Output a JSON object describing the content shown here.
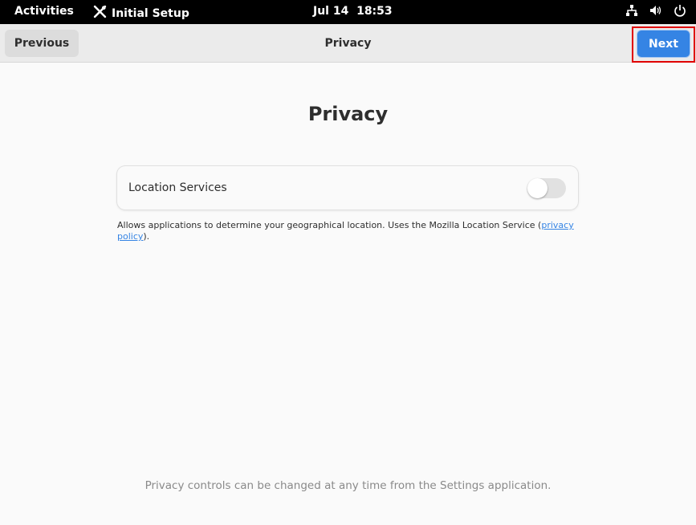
{
  "topbar": {
    "activities": "Activities",
    "app_name": "Initial Setup",
    "app_icon": "tools-icon",
    "clock": "Jul 14  18:53",
    "tray_icons": [
      "network-icon",
      "volume-icon",
      "power-icon"
    ]
  },
  "header": {
    "previous_label": "Previous",
    "title": "Privacy",
    "next_label": "Next"
  },
  "main": {
    "title": "Privacy",
    "location_services": {
      "label": "Location Services",
      "enabled": false
    },
    "description_text": "Allows applications to determine your geographical location. Uses the Mozilla Location Service (",
    "description_link": "privacy policy",
    "description_end": ").",
    "footer": "Privacy controls can be changed at any time from the Settings application."
  },
  "colors": {
    "accent": "#3584e4",
    "highlight_frame": "#e00000"
  }
}
